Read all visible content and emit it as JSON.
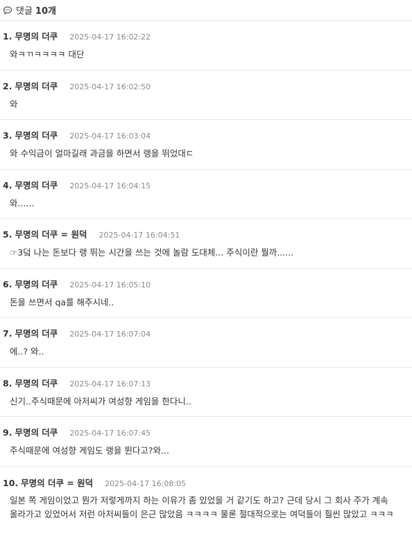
{
  "header": {
    "label": "댓글",
    "count": "10개"
  },
  "comments": [
    {
      "num": "1.",
      "author": "무명의 더쿠",
      "time": "2025-04-17 16:02:22",
      "body": "와ㅋㄲㅋㅋㅋㅋ 대단"
    },
    {
      "num": "2.",
      "author": "무명의 더쿠",
      "time": "2025-04-17 16:02:50",
      "body": "와"
    },
    {
      "num": "3.",
      "author": "무명의 더쿠",
      "time": "2025-04-17 16:03:04",
      "body": "와 수익금이 얼마길래 과금을 하면서 랭을 뛰었대ㄷ"
    },
    {
      "num": "4.",
      "author": "무명의 더쿠",
      "time": "2025-04-17 16:04:15",
      "body": "와......"
    },
    {
      "num": "5.",
      "author": "무명의 더쿠 = 원덕",
      "time": "2025-04-17 16:04:51",
      "body": "☞3덬 나는 돈보다 랭 뛰는 시간을 쓰는 것에 놀람 도대체... 주식이란 뭘까......"
    },
    {
      "num": "6.",
      "author": "무명의 더쿠",
      "time": "2025-04-17 16:05:10",
      "body": "돈을 쓰면서 qa를 해주시네.."
    },
    {
      "num": "7.",
      "author": "무명의 더쿠",
      "time": "2025-04-17 16:07:04",
      "body": "에..? 와.."
    },
    {
      "num": "8.",
      "author": "무명의 더쿠",
      "time": "2025-04-17 16:07:13",
      "body": "신기..주식때문에 아저씨가 여성향 게임을 한다니.."
    },
    {
      "num": "9.",
      "author": "무명의 더쿠",
      "time": "2025-04-17 16:07:45",
      "body": "주식때문에 여성향 게임도 랭을 뛴다고?와..."
    },
    {
      "num": "10.",
      "author": "무명의 더쿠 = 원덕",
      "time": "2025-04-17 16:08:05",
      "body": "일본 쪽 게임이었고 뭔가 저렇게까지 하는 이유가 좀 있었을 거 같기도 하고? 근데 당시 그 회사 주가 계속 올라가고 있었어서 저런 아저씨들이 은근 많았음 ㅋㅋㅋㅋ 물론 절대적으로는 여덕들이 훨씬 많았고 ㅋㅋㅋ"
    }
  ]
}
